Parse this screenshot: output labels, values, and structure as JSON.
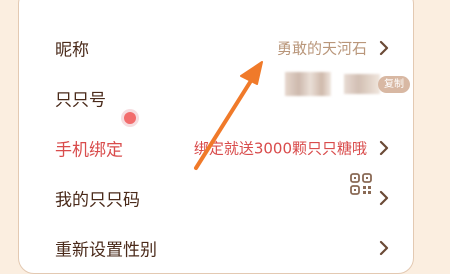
{
  "rows": [
    {
      "label": "昵称",
      "value": "勇敢的天河石"
    },
    {
      "label": "只只号",
      "copy_label": "复制"
    },
    {
      "label": "手机绑定",
      "value": "绑定就送3000颗只只糖哦"
    },
    {
      "label": "我的只只码"
    },
    {
      "label": "重新设置性别"
    }
  ],
  "colors": {
    "background": "#fbeee0",
    "card_border": "#e3c9b2",
    "label": "#4a2a1a",
    "value": "#b9967a",
    "highlight_red": "#d94c4c",
    "arrow": "#f07a2a"
  },
  "icons": [
    "chevron-right-icon",
    "qr-code-icon",
    "notification-dot",
    "annotation-arrow"
  ]
}
